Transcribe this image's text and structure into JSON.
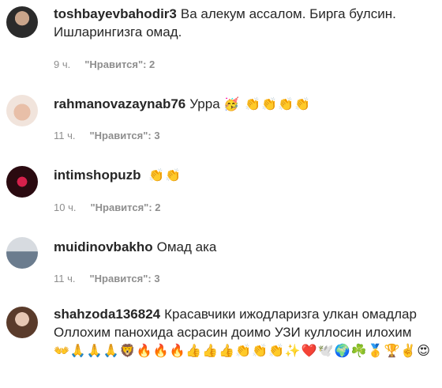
{
  "comments": [
    {
      "username": "toshbayevbahodir3",
      "text": "Ва алекум ассалом. Бирга булсин. Ишларингизга омад.",
      "time": "9 ч.",
      "likes": "\"Нравится\": 2"
    },
    {
      "username": "rahmanovazaynab76",
      "text": "Урра",
      "emoji": "🥳 👏👏👏👏",
      "time": "11 ч.",
      "likes": "\"Нравится\": 3"
    },
    {
      "username": "intimshopuzb",
      "text": "",
      "emoji": "👏👏",
      "time": "10 ч.",
      "likes": "\"Нравится\": 2"
    },
    {
      "username": "muidinovbakho",
      "text": "Омад ака",
      "time": "11 ч.",
      "likes": "\"Нравится\": 3"
    },
    {
      "username": "shahzoda136824",
      "text": "Красавчики ижодларизга улкан омадлар Оллохим панохида асрасин доимо УЗИ куллосин илохим",
      "emoji": "👐🙏🙏🙏🦁🔥🔥🔥👍👍👍👏👏👏✨❤️🕊️🌍☘️🥇🏆✌️😍"
    }
  ]
}
